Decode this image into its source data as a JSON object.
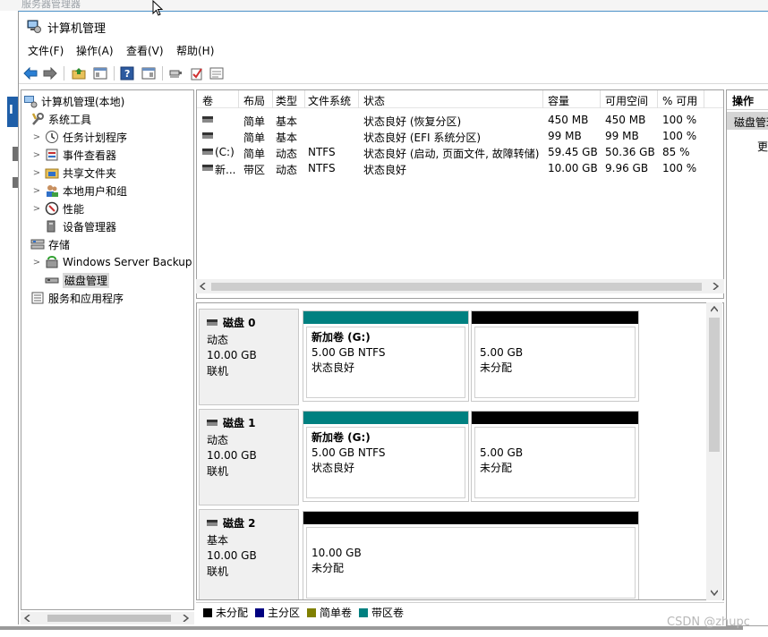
{
  "background": {
    "window_title": "服务器管理器",
    "tile_letter": "I"
  },
  "window": {
    "title": "计算机管理"
  },
  "menu": [
    {
      "label": "文件(F)"
    },
    {
      "label": "操作(A)"
    },
    {
      "label": "查看(V)"
    },
    {
      "label": "帮助(H)"
    }
  ],
  "toolbar": {
    "buttons": [
      "back-icon",
      "forward-icon",
      "up-folder-icon",
      "show-hide-tree-icon",
      "help-icon",
      "action-pane-icon",
      "connect-icon",
      "check-icon",
      "properties-icon"
    ]
  },
  "tree": {
    "items": [
      {
        "label": "计算机管理(本地)",
        "level": 0,
        "expander": "",
        "icon": "computer-management-icon"
      },
      {
        "label": "系统工具",
        "level": 1,
        "expander": "",
        "icon": "system-tools-icon"
      },
      {
        "label": "任务计划程序",
        "level": 2,
        "expander": ">",
        "icon": "task-scheduler-icon"
      },
      {
        "label": "事件查看器",
        "level": 2,
        "expander": ">",
        "icon": "event-viewer-icon"
      },
      {
        "label": "共享文件夹",
        "level": 2,
        "expander": ">",
        "icon": "shared-folders-icon"
      },
      {
        "label": "本地用户和组",
        "level": 2,
        "expander": ">",
        "icon": "local-users-icon"
      },
      {
        "label": "性能",
        "level": 2,
        "expander": ">",
        "icon": "performance-icon"
      },
      {
        "label": "设备管理器",
        "level": 2,
        "expander": "",
        "icon": "device-manager-icon"
      },
      {
        "label": "存储",
        "level": 1,
        "expander": "",
        "icon": "storage-icon"
      },
      {
        "label": "Windows Server Backup",
        "level": 2,
        "expander": ">",
        "icon": "backup-icon"
      },
      {
        "label": "磁盘管理",
        "level": 2,
        "expander": "",
        "icon": "disk-management-icon",
        "selected": true
      },
      {
        "label": "服务和应用程序",
        "level": 1,
        "expander": "",
        "icon": "services-apps-icon"
      }
    ]
  },
  "volumes": {
    "columns": [
      "卷",
      "布局",
      "类型",
      "文件系统",
      "状态",
      "容量",
      "可用空间",
      "% 可用"
    ],
    "rows": [
      [
        "",
        "简单",
        "基本",
        "",
        "状态良好 (恢复分区)",
        "450 MB",
        "450 MB",
        "100 %"
      ],
      [
        "",
        "简单",
        "基本",
        "",
        "状态良好 (EFI 系统分区)",
        "99 MB",
        "99 MB",
        "100 %"
      ],
      [
        "(C:)",
        "简单",
        "动态",
        "NTFS",
        "状态良好 (启动, 页面文件, 故障转储)",
        "59.45 GB",
        "50.36 GB",
        "85 %"
      ],
      [
        "新...",
        "带区",
        "动态",
        "NTFS",
        "状态良好",
        "10.00 GB",
        "9.96 GB",
        "100 %"
      ]
    ]
  },
  "disks": [
    {
      "name": "磁盘 0",
      "type": "动态",
      "size": "10.00 GB",
      "status": "联机",
      "partitions": [
        {
          "cap_color": "#008080",
          "lines": [
            "新加卷 (G:)",
            "5.00 GB NTFS",
            "状态良好"
          ],
          "bold_first": true
        },
        {
          "cap_color": "#000000",
          "lines": [
            "5.00 GB",
            "未分配"
          ],
          "bold_first": false,
          "pad_top": true
        }
      ]
    },
    {
      "name": "磁盘 1",
      "type": "动态",
      "size": "10.00 GB",
      "status": "联机",
      "partitions": [
        {
          "cap_color": "#008080",
          "lines": [
            "新加卷 (G:)",
            "5.00 GB NTFS",
            "状态良好"
          ],
          "bold_first": true
        },
        {
          "cap_color": "#000000",
          "lines": [
            "5.00 GB",
            "未分配"
          ],
          "bold_first": false,
          "pad_top": true
        }
      ]
    },
    {
      "name": "磁盘 2",
      "type": "基本",
      "size": "10.00 GB",
      "status": "联机",
      "partitions": [
        {
          "cap_color": "#000000",
          "lines": [
            "10.00 GB",
            "未分配"
          ],
          "bold_first": false,
          "pad_top": true
        }
      ]
    }
  ],
  "legend": [
    {
      "label": "未分配",
      "color": "#000000"
    },
    {
      "label": "主分区",
      "color": "#000080"
    },
    {
      "label": "简单卷",
      "color": "#808000"
    },
    {
      "label": "带区卷",
      "color": "#008080"
    }
  ],
  "actions": {
    "header": "操作",
    "section": "磁盘管理",
    "more": "更多操作"
  },
  "watermark": "CSDN @zhupc"
}
